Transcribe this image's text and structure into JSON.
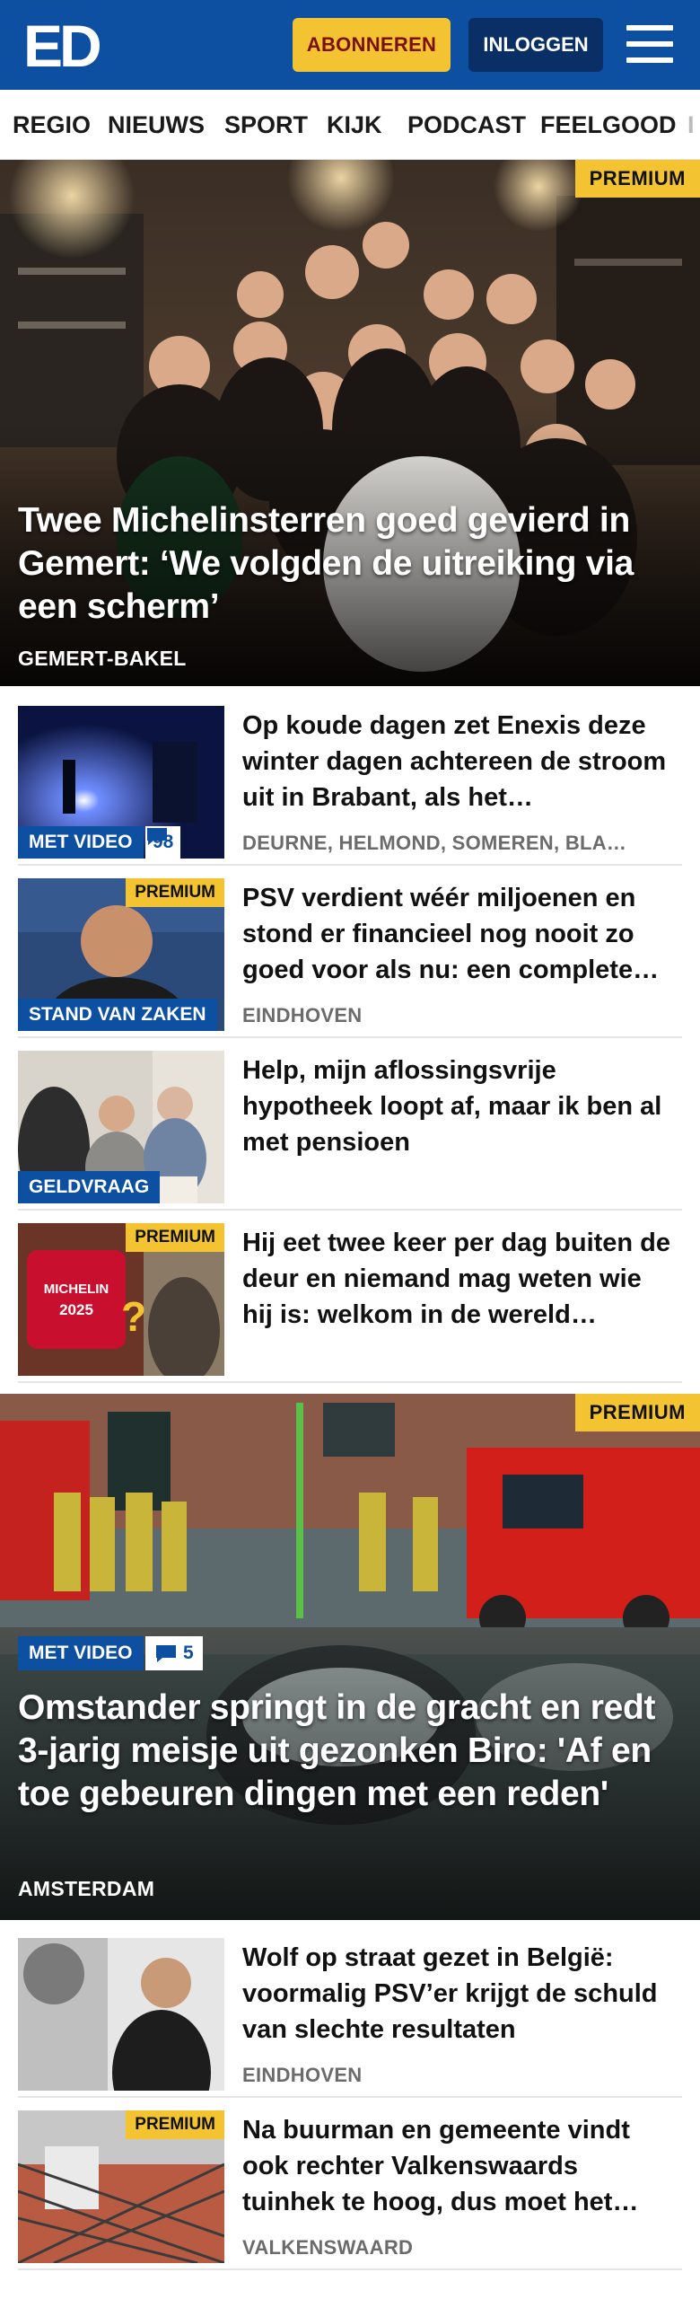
{
  "header": {
    "logo_text": "ED",
    "subscribe_label": "ABONNEREN",
    "login_label": "INLOGGEN",
    "menu_icon": "hamburger-menu-icon",
    "colors": {
      "brand_blue": "#0d4fa0",
      "dark_blue": "#0a2f66",
      "yellow": "#f3c331",
      "subscribe_text": "#7a1010"
    }
  },
  "nav": {
    "items": [
      "REGIO",
      "NIEUWS",
      "SPORT",
      "KIJK",
      "PODCAST",
      "FEELGOOD",
      "I"
    ]
  },
  "hero1": {
    "premium_label": "PREMIUM",
    "title": "Twee Michelinsterren goed gevierd in Gemert: ‘We volgden de uitreiking via een scherm’",
    "location": "GEMERT-BAKEL"
  },
  "articles_a": [
    {
      "title": "Op koude dagen zet Enexis deze winter dagen achtereen de stroom uit in Brabant, als het…",
      "location": "DEURNE, HELMOND, SOMEREN, BLA…",
      "label": "MET VIDEO",
      "comments": "98"
    },
    {
      "title": "PSV verdient wéér miljoenen en stond er financieel nog nooit zo goed voor als nu: een complete…",
      "location": "EINDHOVEN",
      "label": "STAND VAN ZAKEN",
      "premium": "PREMIUM"
    },
    {
      "title": "Help, mijn aflossingsvrije hypotheek loopt af, maar ik ben al met pensioen",
      "label": "GELDVRAAG"
    },
    {
      "title": "Hij eet twee keer per dag buiten de deur en niemand mag weten wie hij is: welkom in de wereld…",
      "premium": "PREMIUM",
      "thumb_text": "MICHELIN 2025"
    }
  ],
  "hero2": {
    "premium_label": "PREMIUM",
    "video_label": "MET VIDEO",
    "comments": "5",
    "title": "Omstander springt in de gracht en redt 3-jarig meisje uit gezonken Biro: 'Af en toe gebeuren dingen met een reden'",
    "location": "AMSTERDAM"
  },
  "articles_b": [
    {
      "title": "Wolf op straat gezet in België: voormalig PSV’er krijgt de schuld van slechte resultaten",
      "location": "EINDHOVEN"
    },
    {
      "title": "Na buurman en gemeente vindt ook rechter Valkenswaards tuinhek te hoog, dus moet het…",
      "location": "VALKENSWAARD",
      "premium": "PREMIUM"
    }
  ]
}
